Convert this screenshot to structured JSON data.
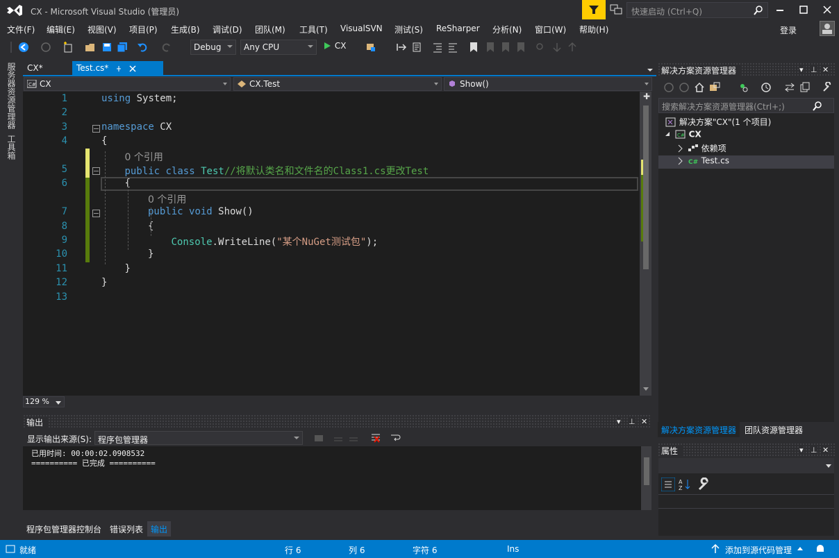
{
  "window": {
    "title": "CX - Microsoft Visual Studio (管理员)",
    "quick_launch_placeholder": "快速启动 (Ctrl+Q)",
    "login": "登录"
  },
  "menu": [
    "文件(F)",
    "编辑(E)",
    "视图(V)",
    "项目(P)",
    "生成(B)",
    "调试(D)",
    "团队(M)",
    "工具(T)",
    "VisualSVN",
    "测试(S)",
    "ReSharper",
    "分析(N)",
    "窗口(W)",
    "帮助(H)"
  ],
  "toolbar": {
    "config": "Debug",
    "platform": "Any CPU",
    "start_label": "CX"
  },
  "left_tabs": [
    "服务器资源管理器",
    "工具箱"
  ],
  "doc_tabs": {
    "cx": "CX*",
    "test": "Test.cs*"
  },
  "nav": {
    "project": "CX",
    "type": "CX.Test",
    "member": "Show()"
  },
  "editor": {
    "zoom": "129 %",
    "lines": [
      {
        "n": "1",
        "code": [
          [
            "kw",
            "using"
          ],
          [
            "p",
            " System;"
          ]
        ]
      },
      {
        "n": "2",
        "code": []
      },
      {
        "n": "3",
        "code": [
          [
            "kw",
            "namespace"
          ],
          [
            "p",
            " CX"
          ]
        ]
      },
      {
        "n": "4",
        "code": [
          [
            "p",
            "{"
          ]
        ]
      },
      {
        "n": "",
        "code": [
          [
            "lens",
            "0 个引用"
          ]
        ]
      },
      {
        "n": "5",
        "code": [
          [
            "kw",
            "public"
          ],
          [
            "p",
            " "
          ],
          [
            "kw",
            "class"
          ],
          [
            "p",
            " "
          ],
          [
            "ty",
            "Test"
          ],
          [
            "cm",
            "//将默认类名和文件名的Class1.cs更改Test"
          ]
        ]
      },
      {
        "n": "6",
        "code": [
          [
            "p",
            "{"
          ]
        ]
      },
      {
        "n": "",
        "code": [
          [
            "lens",
            "0 个引用"
          ]
        ]
      },
      {
        "n": "7",
        "code": [
          [
            "kw",
            "public"
          ],
          [
            "p",
            " "
          ],
          [
            "kw",
            "void"
          ],
          [
            "p",
            " Show()"
          ]
        ]
      },
      {
        "n": "8",
        "code": [
          [
            "p",
            "{"
          ]
        ]
      },
      {
        "n": "9",
        "code": [
          [
            "ty",
            "Console"
          ],
          [
            "p",
            "."
          ],
          [
            "p",
            "WriteLine("
          ],
          [
            "st",
            "\"某个NuGet测试包\""
          ],
          [
            "p",
            ");"
          ]
        ]
      },
      {
        "n": "10",
        "code": [
          [
            "p",
            "}"
          ]
        ]
      },
      {
        "n": "11",
        "code": [
          [
            "p",
            "}"
          ]
        ]
      },
      {
        "n": "12",
        "code": [
          [
            "p",
            "}"
          ]
        ]
      },
      {
        "n": "13",
        "code": []
      }
    ]
  },
  "output": {
    "title": "输出",
    "source_label": "显示输出来源(S):",
    "source_value": "程序包管理器",
    "lines": [
      "已用时间: 00:00:02.0908532",
      "========== 已完成 =========="
    ]
  },
  "bottom_tabs": [
    "程序包管理器控制台",
    "错误列表",
    "输出"
  ],
  "solution": {
    "title": "解决方案资源管理器",
    "search_placeholder": "搜索解决方案资源管理器(Ctrl+;)",
    "root": "解决方案\"CX\"(1 个项目)",
    "project": "CX",
    "deps": "依赖项",
    "file": "Test.cs"
  },
  "sol_tabs": [
    "解决方案资源管理器",
    "团队资源管理器"
  ],
  "properties": {
    "title": "属性"
  },
  "status": {
    "ready": "就绪",
    "row": "行 6",
    "col": "列 6",
    "ch": "字符 6",
    "ins": "Ins",
    "scc": "添加到源代码管理"
  },
  "colors": {
    "accent": "#007acc",
    "keyword": "#569cd6",
    "type": "#4ec9b0",
    "comment": "#57a64a",
    "string": "#d69d85",
    "linenum": "#2b91af"
  }
}
